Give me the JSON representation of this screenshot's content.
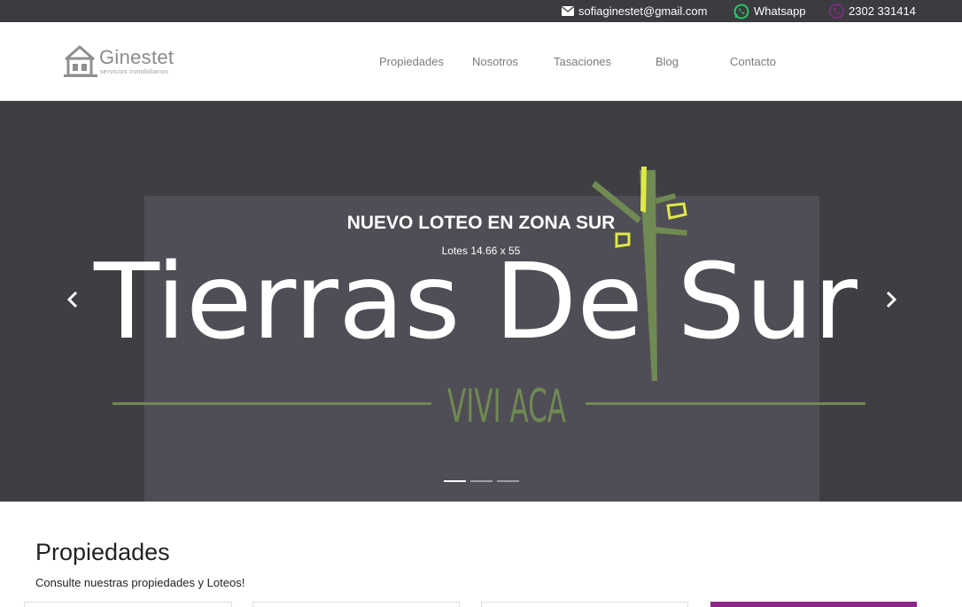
{
  "topbar": {
    "email": "sofiaginestet@gmail.com",
    "whatsapp_label": "Whatsapp",
    "phone": "2302 331414",
    "icons": {
      "email": "envelope-icon",
      "whatsapp": "whatsapp-icon",
      "phone": "phone-icon"
    },
    "colors": {
      "background": "#3b3b40",
      "whatsapp": "#25d366",
      "phone_icon": "#8e278c"
    }
  },
  "header": {
    "logo": {
      "name": "Ginestet",
      "tagline": "servicios inmobiliarios",
      "icon": "house-logo-icon"
    },
    "nav": [
      {
        "label": "Propiedades"
      },
      {
        "label": "Nosotros"
      },
      {
        "label": "Tasaciones"
      },
      {
        "label": "Blog"
      },
      {
        "label": "Contacto"
      }
    ]
  },
  "hero": {
    "caption_title": "NUEVO LOTEO EN ZONA SUR",
    "caption_sub": "Lotes 14.66 x 55",
    "image_text": {
      "main": "Tierras De Sur",
      "tagline": "VIVI ACA"
    },
    "prev_icon": "chevron-left-icon",
    "next_icon": "chevron-right-icon",
    "slide_count": 3,
    "active_slide": 1,
    "colors": {
      "accent_green": "#6f8a52",
      "accent_yellow": "#e0e84a"
    }
  },
  "section": {
    "title": "Propiedades",
    "subtitle": "Consulte nuestras propiedades y Loteos!",
    "accent_color": "#8e278c"
  }
}
